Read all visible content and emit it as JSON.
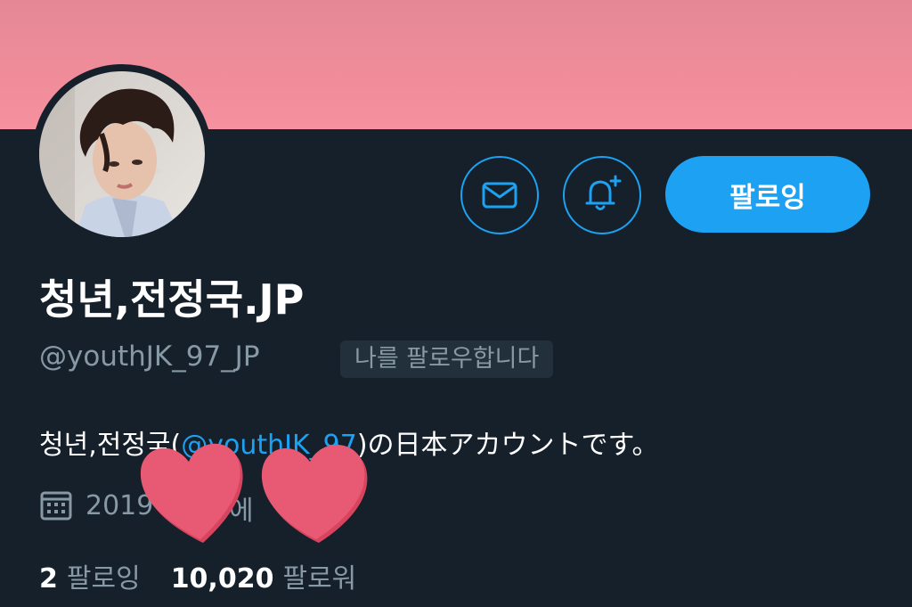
{
  "profile": {
    "display_name": "청년,전정국.JP",
    "handle": "@youthJK_97_JP",
    "follows_you_label": "나를 팔로우합니다",
    "bio_prefix": "청년,전정국(",
    "bio_mention": "@youthJK_97",
    "bio_suffix": ")の日本アカウントです。",
    "joined_visible": "2019",
    "joined_suffix": "에"
  },
  "actions": {
    "message_icon": "envelope-icon",
    "notify_icon": "bell-plus-icon",
    "follow_label": "팔로잉"
  },
  "stats": {
    "following_count": "2",
    "following_label": "팔로잉",
    "followers_count": "10,020",
    "followers_label": "팔로워"
  },
  "colors": {
    "background": "#15202b",
    "accent": "#1da1f2",
    "banner": "#ef8c9a",
    "secondary_text": "#8899a6",
    "heart": "#e85a74"
  }
}
